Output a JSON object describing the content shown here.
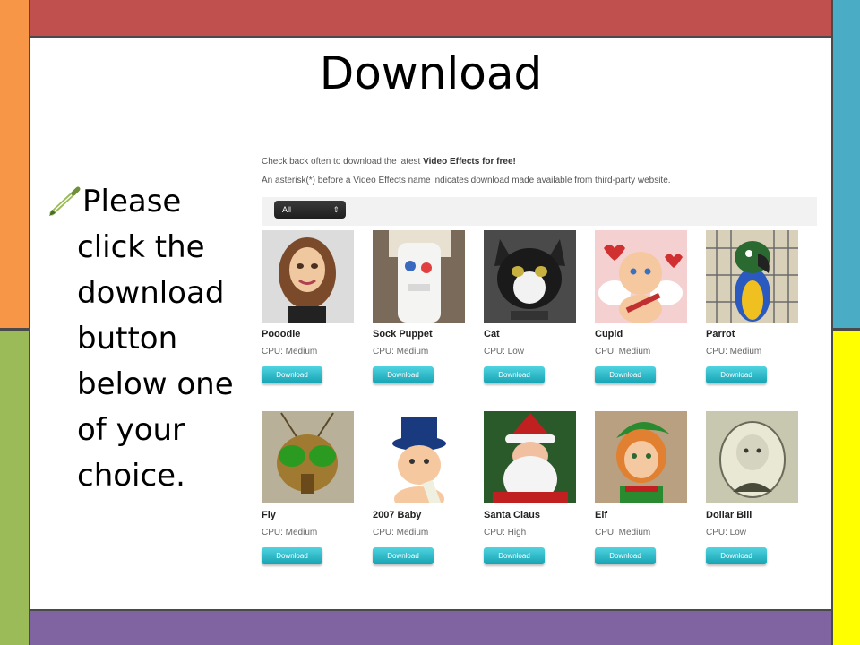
{
  "slide": {
    "title": "Download",
    "bullet_line1": "Please",
    "bullet_rest": "click the download button below one of your choice."
  },
  "site": {
    "intro_prefix": "Check back often to download the latest ",
    "intro_bold": "Video Effects for free!",
    "note": "An asterisk(*) before a Video Effects name indicates download made available from third-party website.",
    "filter_value": "All",
    "download_label": "Download"
  },
  "effects": [
    {
      "name": "Pooodle",
      "cpu": "CPU: Medium"
    },
    {
      "name": "Sock Puppet",
      "cpu": "CPU: Medium"
    },
    {
      "name": "Cat",
      "cpu": "CPU: Low"
    },
    {
      "name": "Cupid",
      "cpu": "CPU: Medium"
    },
    {
      "name": "Parrot",
      "cpu": "CPU: Medium"
    },
    {
      "name": "Fly",
      "cpu": "CPU: Medium"
    },
    {
      "name": "2007 Baby",
      "cpu": "CPU: Medium"
    },
    {
      "name": "Santa Claus",
      "cpu": "CPU: High"
    },
    {
      "name": "Elf",
      "cpu": "CPU: Medium"
    },
    {
      "name": "Dollar Bill",
      "cpu": "CPU: Low"
    }
  ],
  "colors": {
    "top_bar": "#c0504d",
    "bottom_bar": "#8064a2",
    "left_top_bar": "#f79646",
    "left_bottom_bar": "#9bbb59",
    "right_top_bar": "#4bacc6",
    "right_bottom_bar": "#ffff00",
    "download_button": "#22b5c4"
  },
  "icons": {
    "bullet": "pencil-icon",
    "filter": "chevron-updown-icon"
  }
}
